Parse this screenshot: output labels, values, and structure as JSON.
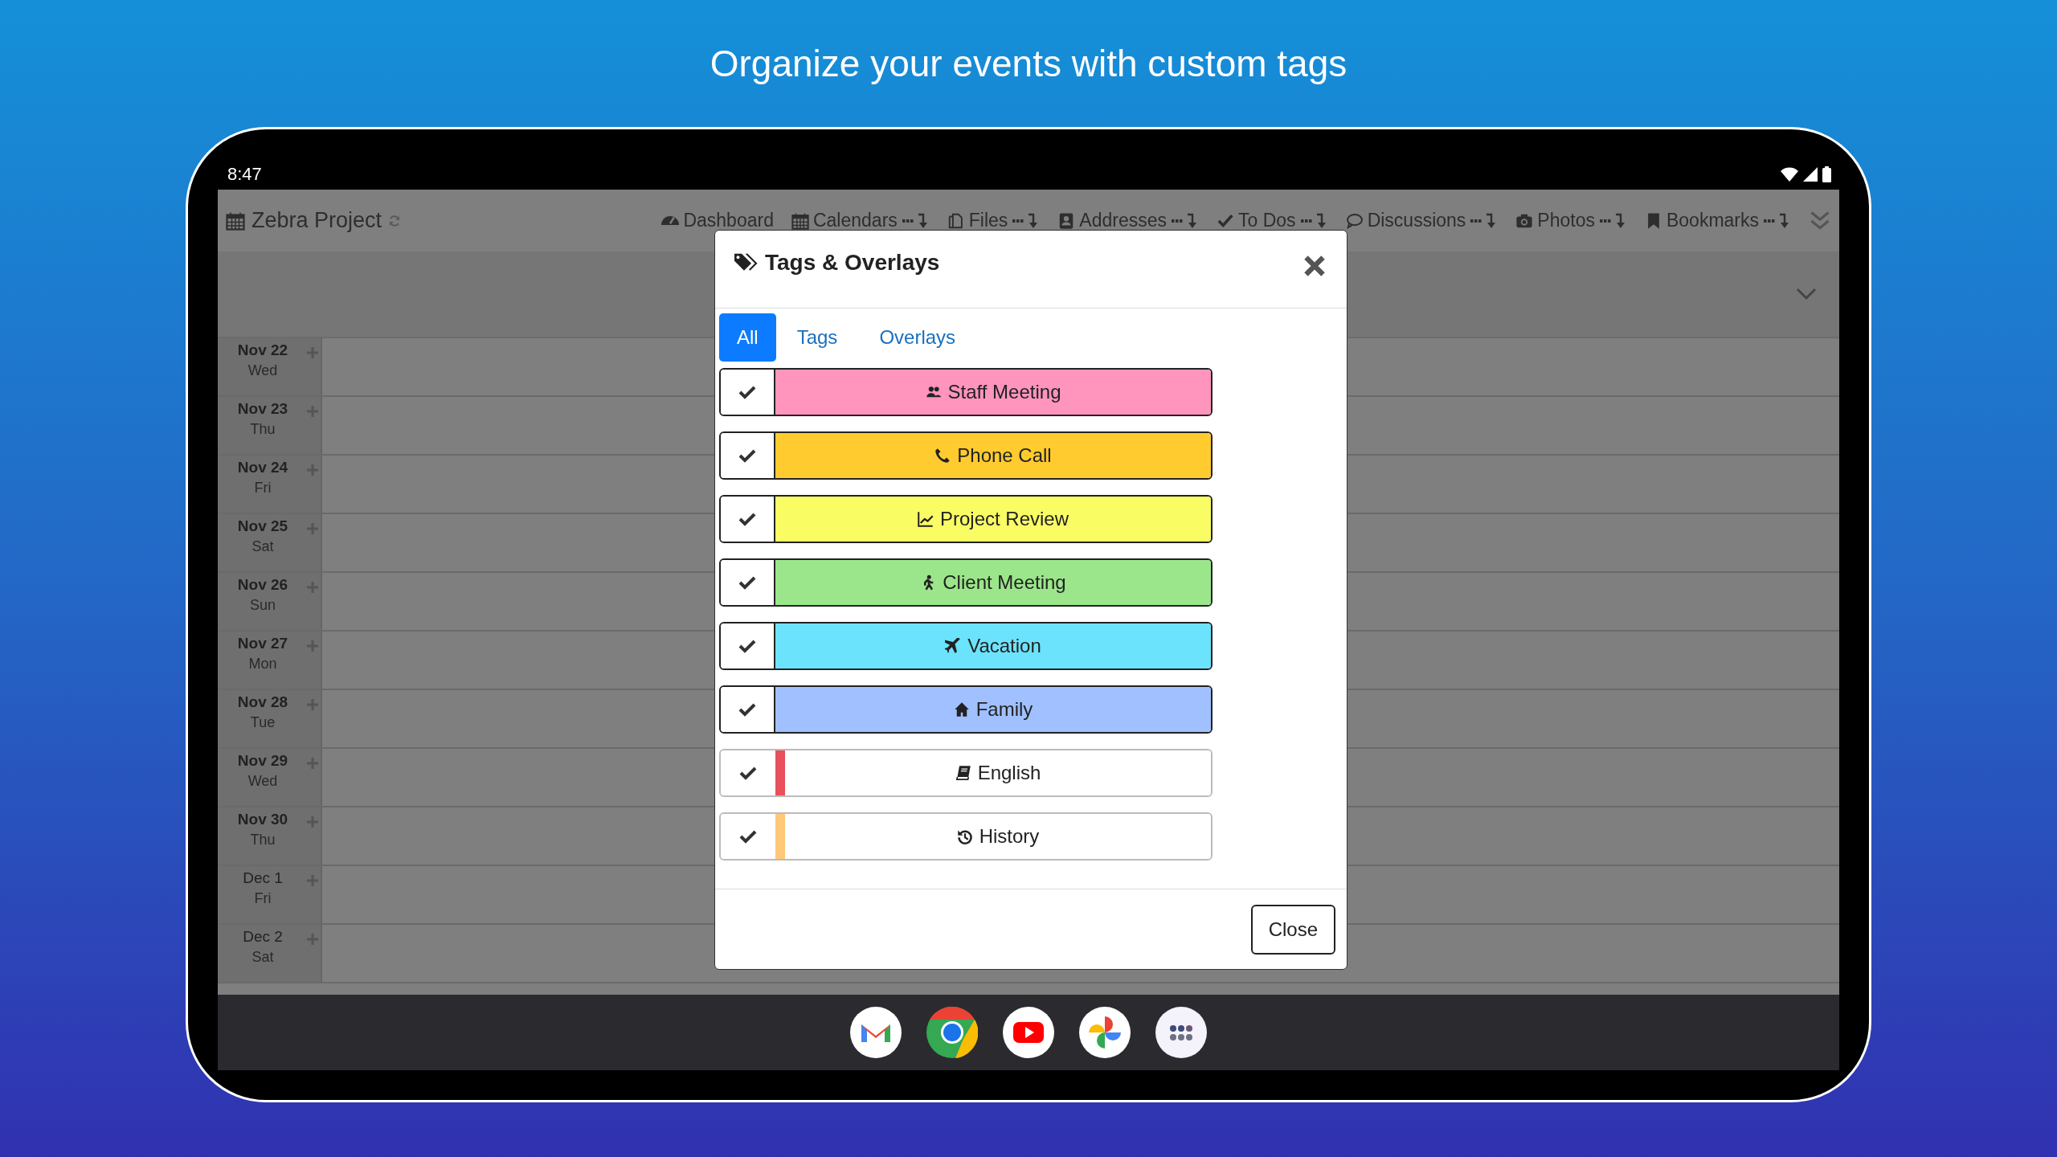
{
  "headline": "Organize your events with custom tags",
  "status_bar": {
    "time": "8:47"
  },
  "app": {
    "title": "Zebra Project",
    "nav": [
      {
        "label": "Dashboard",
        "menu": false
      },
      {
        "label": "Calendars",
        "menu": true
      },
      {
        "label": "Files",
        "menu": true
      },
      {
        "label": "Addresses",
        "menu": true
      },
      {
        "label": "To Dos",
        "menu": true
      },
      {
        "label": "Discussions",
        "menu": true
      },
      {
        "label": "Photos",
        "menu": true
      },
      {
        "label": "Bookmarks",
        "menu": true
      }
    ]
  },
  "days": [
    {
      "date": "Nov 22",
      "weekday": "Wed",
      "current_month": true
    },
    {
      "date": "Nov 23",
      "weekday": "Thu",
      "current_month": true
    },
    {
      "date": "Nov 24",
      "weekday": "Fri",
      "current_month": true
    },
    {
      "date": "Nov 25",
      "weekday": "Sat",
      "current_month": true
    },
    {
      "date": "Nov 26",
      "weekday": "Sun",
      "current_month": true
    },
    {
      "date": "Nov 27",
      "weekday": "Mon",
      "current_month": true
    },
    {
      "date": "Nov 28",
      "weekday": "Tue",
      "current_month": true
    },
    {
      "date": "Nov 29",
      "weekday": "Wed",
      "current_month": true
    },
    {
      "date": "Nov 30",
      "weekday": "Thu",
      "current_month": true
    },
    {
      "date": "Dec 1",
      "weekday": "Fri",
      "current_month": false
    },
    {
      "date": "Dec 2",
      "weekday": "Sat",
      "current_month": false
    }
  ],
  "dialog": {
    "title": "Tags & Overlays",
    "tabs": [
      {
        "label": "All",
        "selected": true
      },
      {
        "label": "Tags",
        "selected": false
      },
      {
        "label": "Overlays",
        "selected": false
      }
    ],
    "tags": [
      {
        "label": "Staff Meeting",
        "kind": "fill",
        "color": "#ff94bd",
        "checked": true
      },
      {
        "label": "Phone Call",
        "kind": "fill",
        "color": "#ffcb2e",
        "checked": true
      },
      {
        "label": "Project Review",
        "kind": "fill",
        "color": "#fafc64",
        "checked": true
      },
      {
        "label": "Client Meeting",
        "kind": "fill",
        "color": "#9be68a",
        "checked": true
      },
      {
        "label": "Vacation",
        "kind": "fill",
        "color": "#6ce3fd",
        "checked": true
      },
      {
        "label": "Family",
        "kind": "fill",
        "color": "#a0c0ff",
        "checked": true
      },
      {
        "label": "English",
        "kind": "stripe",
        "color": "#e8505b",
        "checked": true
      },
      {
        "label": "History",
        "kind": "stripe",
        "color": "#ffc878",
        "checked": true
      }
    ],
    "close_button": "Close"
  }
}
